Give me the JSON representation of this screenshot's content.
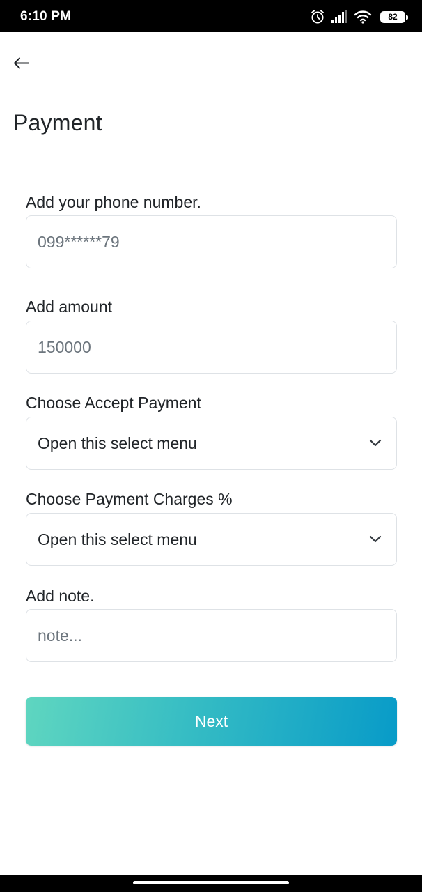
{
  "status_bar": {
    "time": "6:10 PM",
    "battery_level": "82",
    "icons": [
      "alarm-icon",
      "signal-icon",
      "wifi-icon",
      "battery-icon"
    ]
  },
  "header": {
    "back_icon": "arrow-left-icon",
    "title": "Payment"
  },
  "form": {
    "phone": {
      "label": "Add your phone number.",
      "placeholder": "099******79"
    },
    "amount": {
      "label": "Add amount",
      "placeholder": "150000"
    },
    "accept_payment": {
      "label": "Choose Accept Payment",
      "selected": "Open this select menu"
    },
    "payment_charges": {
      "label": "Choose Payment Charges %",
      "selected": "Open this select menu"
    },
    "note": {
      "label": "Add note.",
      "placeholder": "note..."
    },
    "submit_label": "Next"
  },
  "colors": {
    "button_gradient_start": "#5fd6c0",
    "button_gradient_end": "#089bc8",
    "field_border": "#dee2e6",
    "placeholder": "#6c757d"
  }
}
